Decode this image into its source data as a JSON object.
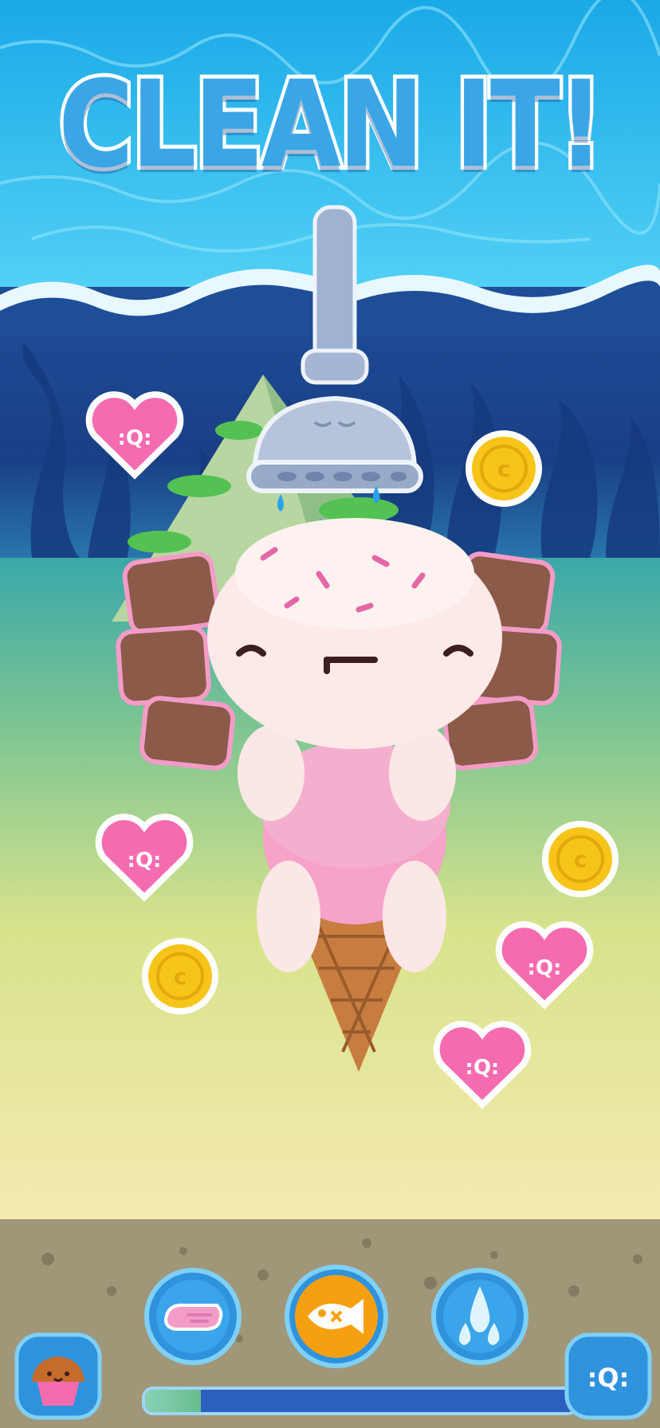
{
  "title": "CLEAN IT!",
  "colors": {
    "sky": "#33c6f2",
    "title_fill": "#3aa6e6",
    "heart": "#f56bb0",
    "coin": "#f7c419",
    "tool_soap": "#f39cc8",
    "tool_fish_bg": "#f6a011",
    "tool_water": "#6fc7ef"
  },
  "collectibles": {
    "hearts": [
      "heart-icon",
      "heart-icon",
      "heart-icon",
      "heart-icon"
    ],
    "coins": [
      "coin-icon",
      "coin-icon",
      "coin-icon"
    ]
  },
  "toolbar": {
    "tools": [
      "sponge-icon",
      "fish-food-icon",
      "water-drop-icon"
    ],
    "selected_tool": "fish-food-icon",
    "menu_icon": "cupcake-icon",
    "currency_icon": "heart-token-icon"
  },
  "progress": 0.13
}
